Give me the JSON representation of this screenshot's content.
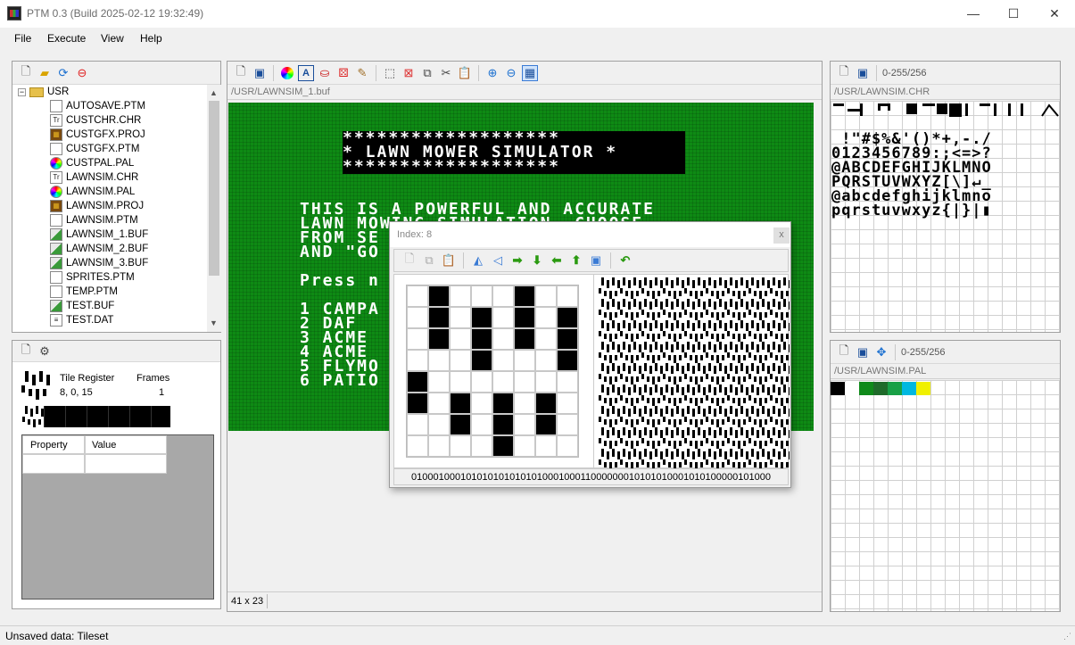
{
  "window": {
    "title": "PTM 0.3 (Build 2025-02-12 19:32:49)",
    "minimize": "—",
    "maximize": "☐",
    "close": "✕"
  },
  "menu": [
    "File",
    "Execute",
    "View",
    "Help"
  ],
  "file_tree": {
    "root": "USR",
    "items": [
      {
        "name": "AUTOSAVE.PTM",
        "icon": "page-icon"
      },
      {
        "name": "CUSTCHR.CHR",
        "icon": "font-icon"
      },
      {
        "name": "CUSTGFX.PROJ",
        "icon": "project-icon"
      },
      {
        "name": "CUSTGFX.PTM",
        "icon": "page-icon"
      },
      {
        "name": "CUSTPAL.PAL",
        "icon": "palette-icon"
      },
      {
        "name": "LAWNSIM.CHR",
        "icon": "font-icon"
      },
      {
        "name": "LAWNSIM.PAL",
        "icon": "palette-icon"
      },
      {
        "name": "LAWNSIM.PROJ",
        "icon": "project-icon"
      },
      {
        "name": "LAWNSIM.PTM",
        "icon": "page-icon"
      },
      {
        "name": "LAWNSIM_1.BUF",
        "icon": "buffer-icon"
      },
      {
        "name": "LAWNSIM_2.BUF",
        "icon": "buffer-icon"
      },
      {
        "name": "LAWNSIM_3.BUF",
        "icon": "buffer-icon"
      },
      {
        "name": "SPRITES.PTM",
        "icon": "page-icon"
      },
      {
        "name": "TEMP.PTM",
        "icon": "page-icon"
      },
      {
        "name": "TEST.BUF",
        "icon": "buffer-icon"
      },
      {
        "name": "TEST.DAT",
        "icon": "data-icon"
      }
    ]
  },
  "tile_panel": {
    "register_label": "Tile Register",
    "register_value": "8, 0, 15",
    "frames_label": "Frames",
    "frames_value": "1",
    "prop_header": "Property",
    "value_header": "Value"
  },
  "buffer": {
    "path": "/USR/LAWNSIM_1.buf",
    "size": "41 x 23",
    "lines": [
      "*******************",
      "* LAWN MOWER SIMULATOR *",
      "*******************",
      "THIS IS A POWERFUL AND ACCURATE",
      "LAWN MOWING SIMULATION. CHOOSE",
      "FROM SE",
      "AND \"GO",
      "Press n",
      "1 CAMPA",
      "2 DAF",
      "3 ACME",
      "4 ACME",
      "5 FLYMO",
      "6 PATIO"
    ]
  },
  "charset": {
    "path": "/USR/LAWNSIM.CHR",
    "range": "0-255/256",
    "rows": [
      " !\"#$%&'()*+,-./",
      "0123456789:;<=>?",
      "@ABCDEFGHIJKLMNO",
      "PQRSTUVWXYZ[\\]↵_",
      "@abcdefghijklmno",
      "pqrstuvwxyz{|}|▮"
    ]
  },
  "palette": {
    "path": "/USR/LAWNSIM.PAL",
    "range": "0-255/256",
    "colors": [
      "#000000",
      "#ffffff",
      "#0f8a1a",
      "#1f6b2a",
      "#18a046",
      "#00b8e0",
      "#f0f000"
    ]
  },
  "dialog": {
    "title": "Index: 8",
    "close": "x",
    "binary": "010001000101010101010101000100011000000010101010001010100000101000",
    "pixels": [
      [
        0,
        1,
        0,
        0,
        0,
        1,
        0,
        0
      ],
      [
        0,
        1,
        0,
        1,
        0,
        1,
        0,
        1
      ],
      [
        0,
        1,
        0,
        1,
        0,
        1,
        0,
        1
      ],
      [
        0,
        0,
        0,
        1,
        0,
        0,
        0,
        1
      ],
      [
        1,
        0,
        0,
        0,
        0,
        0,
        0,
        0
      ],
      [
        1,
        0,
        1,
        0,
        1,
        0,
        1,
        0
      ],
      [
        0,
        0,
        1,
        0,
        1,
        0,
        1,
        0
      ],
      [
        0,
        0,
        0,
        0,
        1,
        0,
        0,
        0
      ]
    ]
  },
  "status": {
    "text": "Unsaved data: Tileset"
  }
}
